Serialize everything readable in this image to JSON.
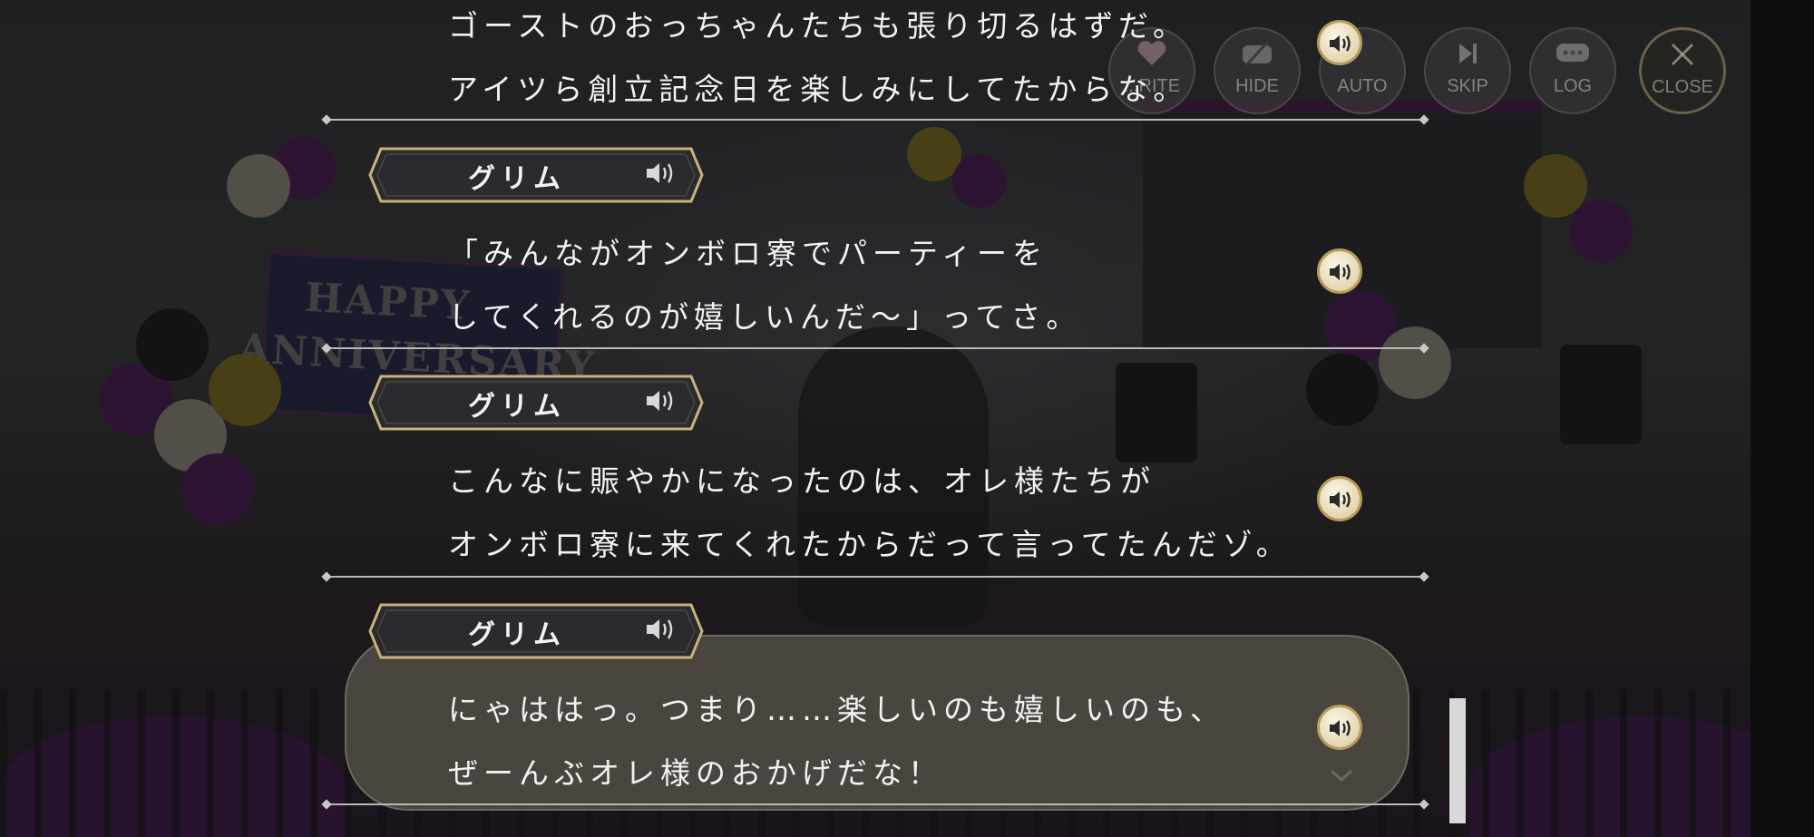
{
  "toolbar": {
    "buttons": [
      {
        "key": "favorite",
        "label": "...RITE",
        "icon": "heart-icon"
      },
      {
        "key": "hide",
        "label": "HIDE",
        "icon": "eye-slash-icon"
      },
      {
        "key": "auto",
        "label": "AUTO",
        "icon": "auto-icon"
      },
      {
        "key": "skip",
        "label": "SKIP",
        "icon": "skip-icon"
      },
      {
        "key": "log",
        "label": "LOG",
        "icon": "log-icon"
      },
      {
        "key": "close",
        "label": "CLOSE",
        "icon": "close-icon"
      }
    ]
  },
  "background": {
    "sign_text_1": "HAPPY",
    "sign_text_2": "ANNIVERSARY"
  },
  "log": [
    {
      "speaker": "",
      "lines": [
        "ゴーストのおっちゃんたちも張り切るはずだ。",
        "アイツら創立記念日を楽しみにしてたからな。"
      ]
    },
    {
      "speaker": "グリム",
      "lines": [
        "「みんながオンボロ寮でパーティーを",
        "してくれるのが嬉しいんだ～」ってさ。"
      ]
    },
    {
      "speaker": "グリム",
      "lines": [
        "こんなに賑やかになったのは、オレ様たちが",
        "オンボロ寮に来てくれたからだって言ってたんだゾ。"
      ]
    },
    {
      "speaker": "グリム",
      "lines": [
        "にゃははっ。つまり……楽しいのも嬉しいのも、",
        "ぜーんぶオレ様のおかげだな！"
      ]
    }
  ],
  "colors": {
    "text": "#f2f2f2",
    "voice_button": "#e9dfc0",
    "nameplate_border": "#c9b27a",
    "current_box": "#4e4a42"
  }
}
